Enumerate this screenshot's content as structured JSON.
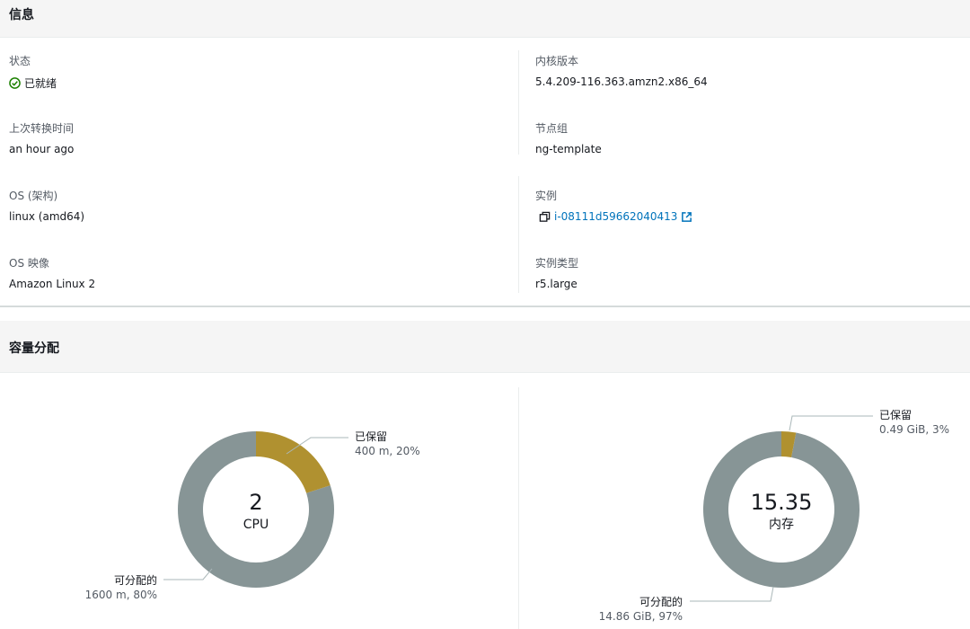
{
  "info": {
    "title": "信息",
    "status_label": "状态",
    "status_value": "已就绪",
    "last_transition_label": "上次转换时间",
    "last_transition_value": "an hour ago",
    "os_arch_label": "OS (架构)",
    "os_arch_value": "linux (amd64)",
    "os_image_label": "OS 映像",
    "os_image_value": "Amazon Linux 2",
    "kernel_label": "内核版本",
    "kernel_value": "5.4.209-116.363.amzn2.x86_64",
    "nodegroup_label": "节点组",
    "nodegroup_value": "ng-template",
    "instance_label": "实例",
    "instance_value": "i-08111d59662040413",
    "instance_type_label": "实例类型",
    "instance_type_value": "r5.large"
  },
  "capacity": {
    "title": "容量分配"
  },
  "colors": {
    "reserved": "#b09130",
    "allocatable": "#879596",
    "link": "#0073bb",
    "success": "#1d8102"
  },
  "icons": {
    "status": "check-circle-icon",
    "copy": "copy-icon",
    "external": "external-link-icon"
  },
  "chart_data": [
    {
      "type": "pie",
      "center_value": "2",
      "center_unit": "CPU",
      "slices": [
        {
          "label": "已保留",
          "detail": "400 m, 20%",
          "value": 20
        },
        {
          "label": "可分配的",
          "detail": "1600 m, 80%",
          "value": 80
        }
      ]
    },
    {
      "type": "pie",
      "center_value": "15.35",
      "center_unit": "内存",
      "slices": [
        {
          "label": "已保留",
          "detail": "0.49 GiB, 3%",
          "value": 3
        },
        {
          "label": "可分配的",
          "detail": "14.86 GiB, 97%",
          "value": 97
        }
      ]
    }
  ]
}
